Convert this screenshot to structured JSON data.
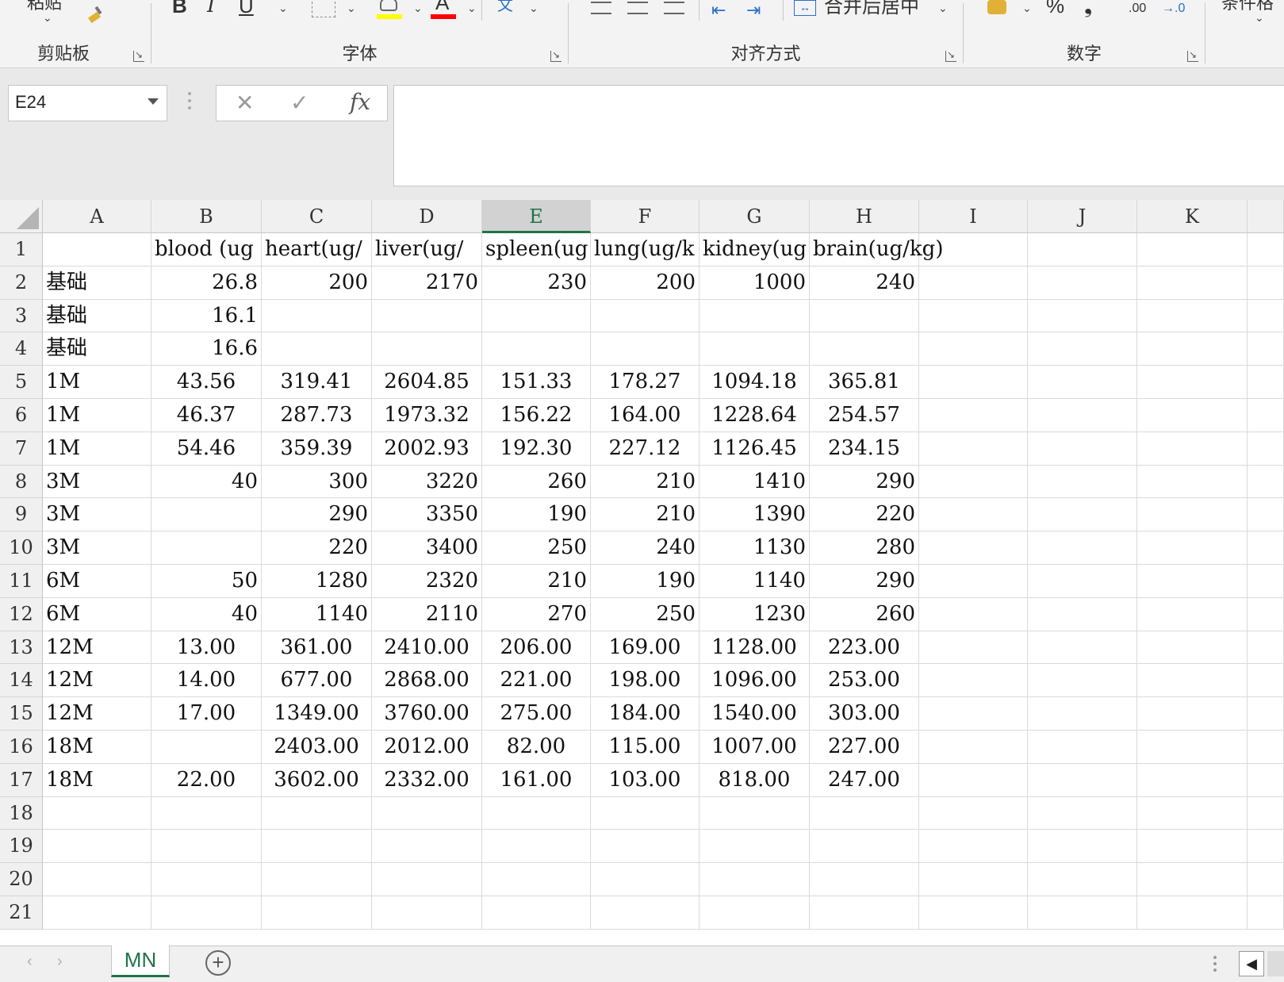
{
  "ribbon": {
    "clipboard": {
      "label": "剪贴板",
      "paste_label": "粘贴"
    },
    "font": {
      "label": "字体",
      "bold": "B",
      "italic": "I",
      "underline": "U",
      "font_color_glyph": "A",
      "phonetic_glyph": "文"
    },
    "alignment": {
      "label": "对齐方式",
      "merge_center": "合并后居中"
    },
    "number": {
      "label": "数字",
      "percent": "%",
      "comma": "❟",
      "inc_decimal": ".00",
      "dec_decimal": "→.0"
    },
    "styles": {
      "partial_label": "条件格"
    },
    "colors": {
      "highlight": "#ffff00",
      "font_color": "#ff0000"
    }
  },
  "formula_bar": {
    "name_box": "E24",
    "cancel_icon": "close-icon",
    "enter_icon": "check-icon",
    "fx_label": "fx",
    "formula_value": ""
  },
  "columns": [
    "A",
    "B",
    "C",
    "D",
    "E",
    "F",
    "G",
    "H",
    "I",
    "J",
    "K"
  ],
  "selected_column": "E",
  "rows": [
    {
      "n": "1",
      "cells": [
        "",
        "blood (ug",
        "heart(ug/",
        "liver(ug/",
        "spleen(ug",
        "lung(ug/k",
        "kidney(ug",
        "brain(ug/kg)"
      ]
    },
    {
      "n": "2",
      "cells": [
        "基础",
        "26.8",
        "200",
        "2170",
        "230",
        "200",
        "1000",
        "240"
      ]
    },
    {
      "n": "3",
      "cells": [
        "基础",
        "16.1",
        "",
        "",
        "",
        "",
        "",
        ""
      ]
    },
    {
      "n": "4",
      "cells": [
        "基础",
        "16.6",
        "",
        "",
        "",
        "",
        "",
        ""
      ]
    },
    {
      "n": "5",
      "cells": [
        "1M",
        "43.56",
        "319.41",
        "2604.85",
        "151.33",
        "178.27",
        "1094.18",
        "365.81"
      ]
    },
    {
      "n": "6",
      "cells": [
        "1M",
        "46.37",
        "287.73",
        "1973.32",
        "156.22",
        "164.00",
        "1228.64",
        "254.57"
      ]
    },
    {
      "n": "7",
      "cells": [
        "1M",
        "54.46",
        "359.39",
        "2002.93",
        "192.30",
        "227.12",
        "1126.45",
        "234.15"
      ]
    },
    {
      "n": "8",
      "cells": [
        "3M",
        "40",
        "300",
        "3220",
        "260",
        "210",
        "1410",
        "290"
      ]
    },
    {
      "n": "9",
      "cells": [
        "3M",
        "",
        "290",
        "3350",
        "190",
        "210",
        "1390",
        "220"
      ]
    },
    {
      "n": "10",
      "cells": [
        "3M",
        "",
        "220",
        "3400",
        "250",
        "240",
        "1130",
        "280"
      ]
    },
    {
      "n": "11",
      "cells": [
        "6M",
        "50",
        "1280",
        "2320",
        "210",
        "190",
        "1140",
        "290"
      ]
    },
    {
      "n": "12",
      "cells": [
        "6M",
        "40",
        "1140",
        "2110",
        "270",
        "250",
        "1230",
        "260"
      ]
    },
    {
      "n": "13",
      "cells": [
        "12M",
        "13.00",
        "361.00",
        "2410.00",
        "206.00",
        "169.00",
        "1128.00",
        "223.00"
      ]
    },
    {
      "n": "14",
      "cells": [
        "12M",
        "14.00",
        "677.00",
        "2868.00",
        "221.00",
        "198.00",
        "1096.00",
        "253.00"
      ]
    },
    {
      "n": "15",
      "cells": [
        "12M",
        "17.00",
        "1349.00",
        "3760.00",
        "275.00",
        "184.00",
        "1540.00",
        "303.00"
      ]
    },
    {
      "n": "16",
      "cells": [
        "18M",
        "",
        "2403.00",
        "2012.00",
        "82.00",
        "115.00",
        "1007.00",
        "227.00"
      ]
    },
    {
      "n": "17",
      "cells": [
        "18M",
        "22.00",
        "3602.00",
        "2332.00",
        "161.00",
        "103.00",
        "818.00",
        "247.00"
      ]
    },
    {
      "n": "18",
      "cells": [
        "",
        "",
        "",
        "",
        "",
        "",
        "",
        ""
      ]
    },
    {
      "n": "19",
      "cells": [
        "",
        "",
        "",
        "",
        "",
        "",
        "",
        ""
      ]
    },
    {
      "n": "20",
      "cells": [
        "",
        "",
        "",
        "",
        "",
        "",
        "",
        ""
      ]
    },
    {
      "n": "21",
      "cells": [
        "",
        "",
        "",
        "",
        "",
        "",
        "",
        ""
      ]
    }
  ],
  "sheet_tabs": [
    {
      "label": "MN",
      "active": true
    }
  ],
  "add_sheet_label": "+"
}
